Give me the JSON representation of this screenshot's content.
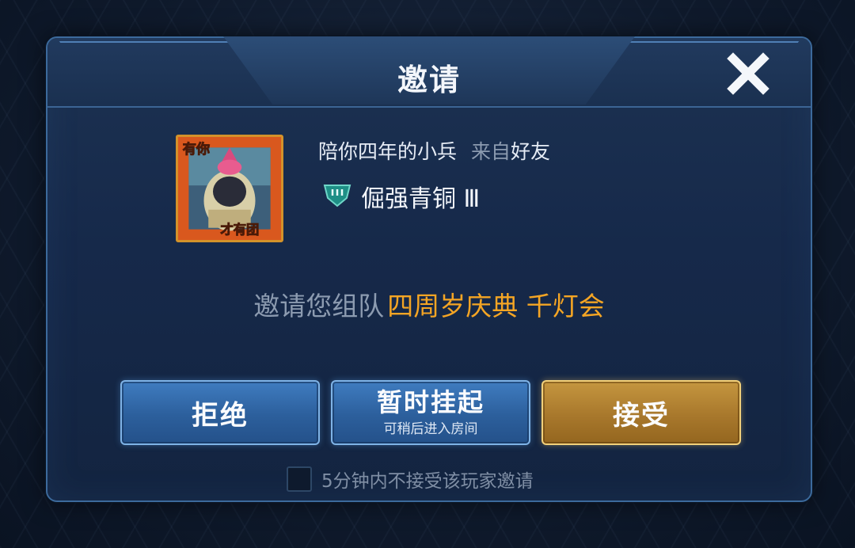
{
  "dialog": {
    "title": "邀请",
    "close_icon": "close-icon"
  },
  "inviter": {
    "name": "陪你四年的小兵",
    "from_label": "来自",
    "from_value": "好友",
    "rank": "倔强青铜 Ⅲ",
    "rank_icon": "bronze-rank-shield-icon",
    "avatar_text_top": "有你",
    "avatar_text_bottom": "才有团"
  },
  "invite": {
    "prefix": "邀请您组队",
    "event": "四周岁庆典 千灯会"
  },
  "buttons": {
    "reject_label": "拒绝",
    "suspend_label": "暂时挂起",
    "suspend_sub": "可稍后进入房间",
    "accept_label": "接受"
  },
  "option": {
    "block_label": "5分钟内不接受该玩家邀请",
    "checked": false
  },
  "colors": {
    "event_text": "#f4a524",
    "accept_button": "#a8782c",
    "blue_button": "#2c5f9c"
  }
}
